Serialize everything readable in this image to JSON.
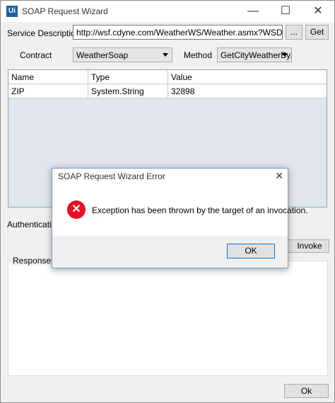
{
  "window": {
    "title": "SOAP Request Wizard",
    "logo_text": "Ui",
    "minimize_glyph": "—",
    "maximize_glyph": "☐",
    "close_glyph": "✕"
  },
  "service": {
    "label": "Service Description",
    "url": "http://wsf.cdyne.com/WeatherWS/Weather.asmx?WSDL",
    "browse_label": "...",
    "get_label": "Get"
  },
  "contract": {
    "label": "Contract",
    "value": "WeatherSoap"
  },
  "method": {
    "label": "Method",
    "value": "GetCityWeatherBy."
  },
  "parameters": {
    "columns": [
      "Name",
      "Type",
      "Value"
    ],
    "rows": [
      [
        "ZIP",
        "System.String",
        "32898"
      ]
    ]
  },
  "authentication": {
    "label": "Authentication"
  },
  "invoke": {
    "label": "Invoke"
  },
  "response": {
    "label": "Response"
  },
  "ok_label": "Ok",
  "dialog": {
    "title": "SOAP Request Wizard Error",
    "close_glyph": "✕",
    "icon_glyph": "✕",
    "message": "Exception has been thrown by the target of an invocation.",
    "ok_label": "OK"
  },
  "colors": {
    "error_icon": "#e81123",
    "logo": "#1f5fa8",
    "grid_background": "#e0e6ec"
  }
}
